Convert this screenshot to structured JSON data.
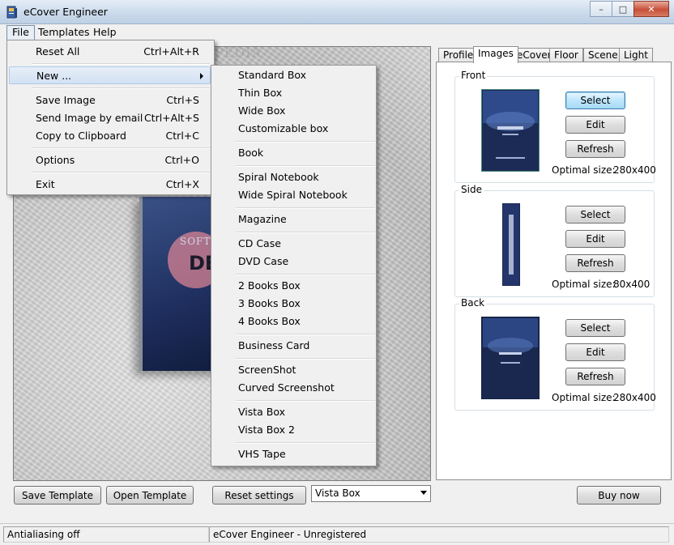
{
  "window": {
    "title": "eCover Engineer"
  },
  "watermark": "SOFTPEDIA",
  "menubar": [
    {
      "label": "File"
    },
    {
      "label": "Templates"
    },
    {
      "label": "Help"
    }
  ],
  "file_menu": [
    {
      "label": "Reset All",
      "shortcut": "Ctrl+Alt+R"
    },
    {
      "label": "New ...",
      "shortcut": ""
    },
    {
      "label": "Save Image",
      "shortcut": "Ctrl+S"
    },
    {
      "label": "Send Image by email",
      "shortcut": "Ctrl+Alt+S"
    },
    {
      "label": "Copy to Clipboard",
      "shortcut": "Ctrl+C"
    },
    {
      "label": "Options",
      "shortcut": "Ctrl+O"
    },
    {
      "label": "Exit",
      "shortcut": "Ctrl+X"
    }
  ],
  "new_submenu": [
    "Standard Box",
    "Thin Box",
    "Wide Box",
    "Customizable box",
    "Book",
    "Spiral Notebook",
    "Wide Spiral Notebook",
    "Magazine",
    "CD Case",
    "DVD Case",
    "2 Books Box",
    "3 Books Box",
    "4 Books Box",
    "Business Card",
    "ScreenShot",
    "Curved Screenshot",
    "Vista Box",
    "Vista Box 2",
    "VHS Tape"
  ],
  "preview": {
    "brand_text": "SOFTPEDIA",
    "demo_text": "DE"
  },
  "tabs": [
    {
      "label": "Profiles"
    },
    {
      "label": "Images"
    },
    {
      "label": "eCover"
    },
    {
      "label": "Floor"
    },
    {
      "label": "Scene"
    },
    {
      "label": "Light"
    }
  ],
  "images_panel": {
    "front": {
      "label": "Front",
      "select": "Select",
      "edit": "Edit",
      "refresh": "Refresh",
      "optimal_label": "Optimal size:",
      "optimal_value": "280x400"
    },
    "side": {
      "label": "Side",
      "select": "Select",
      "edit": "Edit",
      "refresh": "Refresh",
      "optimal_label": "Optimal size:",
      "optimal_value": "80x400"
    },
    "back": {
      "label": "Back",
      "select": "Select",
      "edit": "Edit",
      "refresh": "Refresh",
      "optimal_label": "Optimal size:",
      "optimal_value": "280x400"
    }
  },
  "bottom": {
    "save_template": "Save Template",
    "open_template": "Open Template",
    "reset_settings": "Reset settings",
    "model_combo": "Vista Box",
    "buy_now": "Buy now"
  },
  "status": {
    "left": "Antialiasing off",
    "right": "eCover Engineer - Unregistered"
  }
}
